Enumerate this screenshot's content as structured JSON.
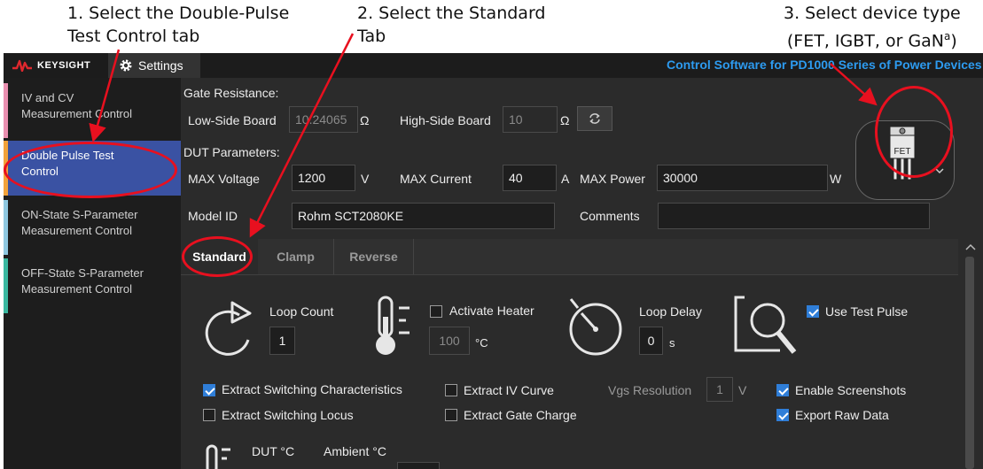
{
  "annotations": {
    "step1_line1": "1. Select the Double-Pulse",
    "step1_line2": "Test Control tab",
    "step2_line1": "2. Select the Standard",
    "step2_line2": "Tab",
    "step3_line1": "3. Select device type",
    "step3_line2_pre": "(FET, IGBT, or GaN",
    "step3_sup": "a",
    "step3_line2_post": ")"
  },
  "topbar": {
    "logo_text": "KEYSIGHT",
    "settings_label": "Settings",
    "app_title": "Control Software for PD1000 Series of Power Devices"
  },
  "sidebar": {
    "items": [
      {
        "line1": "IV and CV",
        "line2": "Measurement Control",
        "accent": "#e98fb0"
      },
      {
        "line1": "Double Pulse Test",
        "line2": "Control",
        "accent": "#f2a23a"
      },
      {
        "line1": "ON-State S-Parameter",
        "line2": "Measurement Control",
        "accent": "#8fc8e0"
      },
      {
        "line1": "OFF-State S-Parameter",
        "line2": "Measurement Control",
        "accent": "#3ab8a0"
      }
    ]
  },
  "gate": {
    "heading": "Gate Resistance:",
    "low_label": "Low-Side Board",
    "low_value": "10.24065",
    "low_unit": "Ω",
    "high_label": "High-Side Board",
    "high_value": "10",
    "high_unit": "Ω"
  },
  "dut": {
    "heading": "DUT Parameters:",
    "max_voltage_label": "MAX Voltage",
    "max_voltage_value": "1200",
    "max_voltage_unit": "V",
    "max_current_label": "MAX Current",
    "max_current_value": "40",
    "max_current_unit": "A",
    "max_power_label": "MAX Power",
    "max_power_value": "30000",
    "max_power_unit": "W",
    "model_label": "Model ID",
    "model_value": "Rohm SCT2080KE",
    "comments_label": "Comments",
    "comments_value": ""
  },
  "device": {
    "type": "FET"
  },
  "tabs": [
    {
      "label": "Standard",
      "active": true
    },
    {
      "label": "Clamp",
      "active": false
    },
    {
      "label": "Reverse",
      "active": false
    }
  ],
  "standard": {
    "loop_count_label": "Loop Count",
    "loop_count_value": "1",
    "heater_label": "Activate Heater",
    "heater_checked": false,
    "heater_value": "100",
    "heater_unit": "°C",
    "loop_delay_label": "Loop Delay",
    "loop_delay_value": "0",
    "loop_delay_unit": "s",
    "use_test_pulse_label": "Use Test Pulse",
    "use_test_pulse_checked": true,
    "extract_switching_char_label": "Extract Switching Characteristics",
    "extract_switching_char_checked": true,
    "extract_switching_locus_label": "Extract Switching Locus",
    "extract_switching_locus_checked": false,
    "extract_iv_label": "Extract IV Curve",
    "extract_iv_checked": false,
    "extract_gate_label": "Extract Gate Charge",
    "extract_gate_checked": false,
    "vgs_resolution_label": "Vgs Resolution",
    "vgs_resolution_value": "1",
    "vgs_resolution_unit": "V",
    "enable_screenshots_label": "Enable Screenshots",
    "enable_screenshots_checked": true,
    "export_raw_label": "Export Raw Data",
    "export_raw_checked": true,
    "dut_temp_label": "DUT °C",
    "ambient_temp_label": "Ambient °C"
  },
  "colors": {
    "annotation_red": "#e8101f",
    "accent_blue": "#2d9bf0",
    "active_item": "#3a52a3",
    "keysight_red": "#e0282e"
  }
}
